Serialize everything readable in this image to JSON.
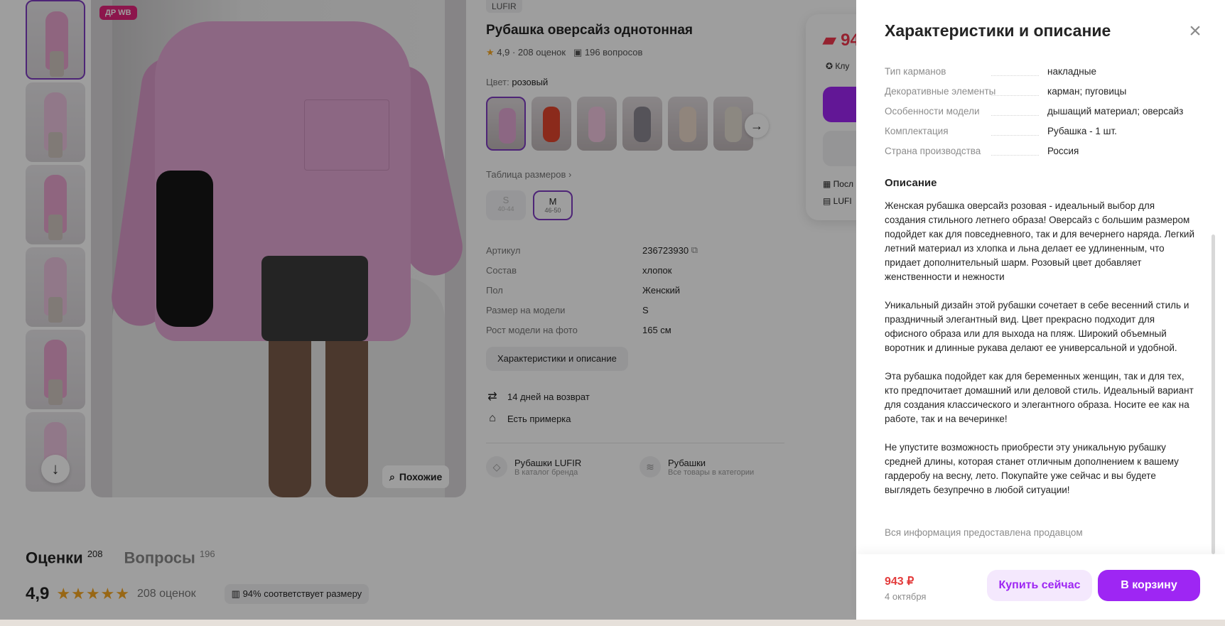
{
  "product": {
    "badge": "ДР WB",
    "similar_label": "Похожие",
    "brand": "LUFIR",
    "title": "Рубашка оверсайз однотонная",
    "rating": "4,9",
    "ratings_count": "208 оценок",
    "questions_count": "196 вопросов",
    "color_label": "Цвет:",
    "color_value": "розовый",
    "size_table_label": "Таблица размеров",
    "sizes": [
      {
        "name": "S",
        "range": "40-44",
        "selected": false
      },
      {
        "name": "M",
        "range": "46-50",
        "selected": true
      }
    ],
    "params": [
      {
        "name": "Артикул",
        "value": "236723930"
      },
      {
        "name": "Состав",
        "value": "хлопок"
      },
      {
        "name": "Пол",
        "value": "Женский"
      },
      {
        "name": "Размер на модели",
        "value": "S"
      },
      {
        "name": "Рост модели на фото",
        "value": "165 см"
      }
    ],
    "characteristics_button": "Характеристики и описание",
    "perks": [
      "14 дней на возврат",
      "Есть примерка"
    ],
    "category_links": [
      {
        "title": "Рубашки LUFIR",
        "subtitle": "В каталог бренда"
      },
      {
        "title": "Рубашки",
        "subtitle": "Все товары в категории"
      }
    ]
  },
  "buy_box": {
    "price_partial": "94",
    "club_partial": "Клу",
    "line1": "Посл",
    "line2": "LUFI"
  },
  "reviews": {
    "tab_reviews": "Оценки",
    "tab_reviews_count": "208",
    "tab_questions": "Вопросы",
    "tab_questions_count": "196",
    "rating": "4,9",
    "stars": "★★★★★",
    "count": "208 оценок",
    "fit": "94% соответствует размеру"
  },
  "panel": {
    "title": "Характеристики и описание",
    "specs": [
      {
        "name": "Тип карманов",
        "value": "накладные"
      },
      {
        "name": "Декоративные элементы",
        "value": "карман; пуговицы"
      },
      {
        "name": "Особенности модели",
        "value": "дышащий материал; оверсайз"
      },
      {
        "name": "Комплектация",
        "value": "Рубашка - 1 шт."
      },
      {
        "name": "Страна производства",
        "value": "Россия"
      }
    ],
    "description_title": "Описание",
    "description": [
      "Женская рубашка оверсайз розовая - идеальный выбор для создания стильного летнего образа! Оверсайз с большим размером подойдет как для повседневного, так и для вечернего наряда. Легкий летний материал из хлопка и льна делает ее удлиненным, что придает дополнительный шарм. Розовый цвет добавляет женственности и нежности",
      "Уникальный дизайн этой рубашки сочетает в себе весенний стиль и праздничный элегантный вид. Цвет прекрасно подходит для офисного образа или для выхода на пляж. Широкий объемный воротник и длинные рукава делают ее универсальной и удобной.",
      "Эта рубашка подойдет как для беременных женщин, так и для тех, кто предпочитает домашний или деловой стиль. Идеальный вариант для создания классического и элегантного образа. Носите ее как на работе, так и на вечеринке!",
      "Не упустите возможность приобрести эту уникальную рубашку средней длины, которая станет отличным дополнением к вашему гардеробу на весну, лето. Покупайте уже сейчас и вы будете выглядеть безупречно в любой ситуации!"
    ],
    "note": "Вся информация предоставлена продавцом",
    "price": "943 ₽",
    "delivery_date": "4 октября",
    "buy_now": "Купить сейчас",
    "add_to_cart": "В корзину"
  },
  "colors": {
    "accent": "#9e26f3",
    "accent_light": "#f4e8fd",
    "price_red": "#e33b3b",
    "overlay": "rgba(0,0,0,0.38)"
  }
}
